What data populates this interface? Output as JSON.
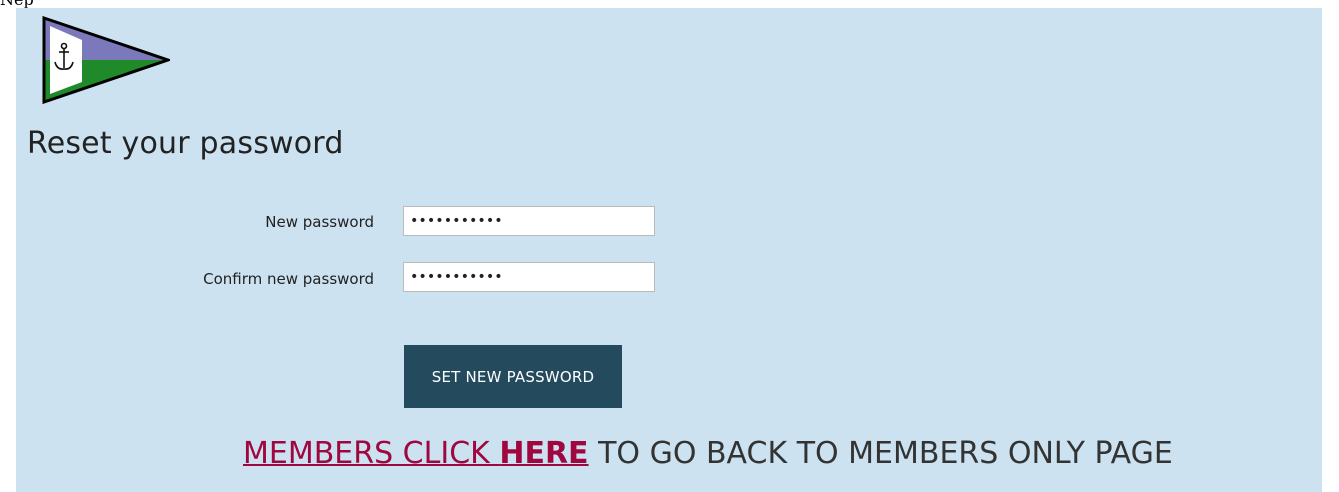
{
  "top_text": "Nep",
  "logo": {
    "colors": {
      "upper": "#7b78bb",
      "lower": "#1f8a2a",
      "hoist": "#ffffff",
      "outline": "#000000"
    },
    "icon": "anchor-icon"
  },
  "page_title": "Reset your password",
  "form": {
    "new_password": {
      "label": "New password",
      "value": "•••••••••••"
    },
    "confirm_password": {
      "label": "Confirm new password",
      "value": "•••••••••••"
    },
    "submit_label": "SET NEW PASSWORD"
  },
  "members_link": {
    "link_prefix": "MEMBERS CLICK ",
    "link_bold": "HERE",
    "suffix": " TO GO BACK TO MEMBERS ONLY PAGE"
  },
  "colors": {
    "panel_bg": "#cce2f0",
    "button_bg": "#244a5e",
    "link_color": "#a0073f"
  }
}
